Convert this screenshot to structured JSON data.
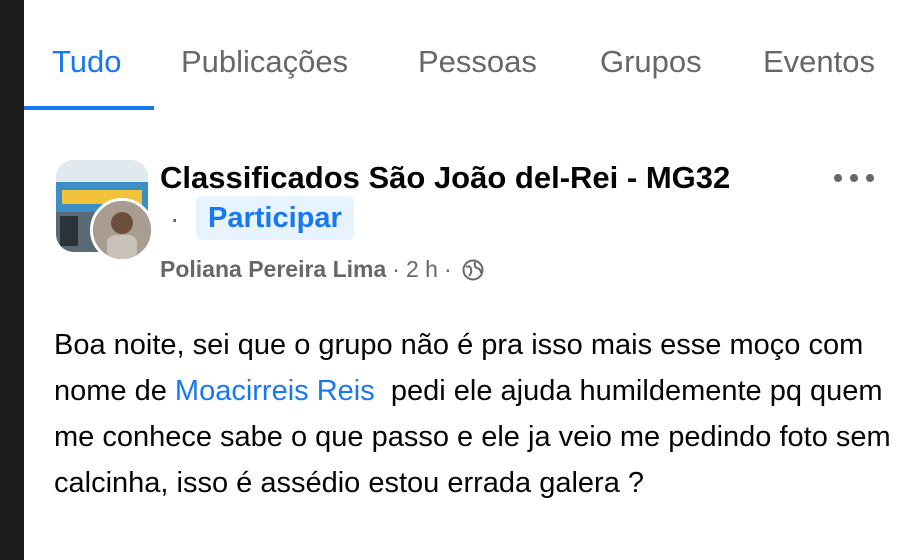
{
  "tabs": [
    {
      "label": "Tudo",
      "active": true
    },
    {
      "label": "Publicações"
    },
    {
      "label": "Pessoas"
    },
    {
      "label": "Grupos"
    },
    {
      "label": "Eventos"
    }
  ],
  "post": {
    "group_name": "Classificados São João del-Rei - MG32",
    "join_label": "Participar",
    "dot": "·",
    "author": "Poliana Pereira Lima",
    "time": "2 h",
    "privacy_icon": "globe-icon",
    "more_icon": "more-horizontal-icon",
    "text_part1": "Boa noite, sei que o grupo não é pra isso mais esse moço com nome de ",
    "mention": "Moacirreis Reis",
    "text_part2": "  pedi ele ajuda humildemente pq quem me conhece sabe o que passo e ele ja veio me pedindo foto sem calcinha, isso é assédio estou errada galera ?"
  },
  "colors": {
    "accent": "#1877f2",
    "secondary_text": "#65676b",
    "join_bg": "#e7f3ff"
  }
}
